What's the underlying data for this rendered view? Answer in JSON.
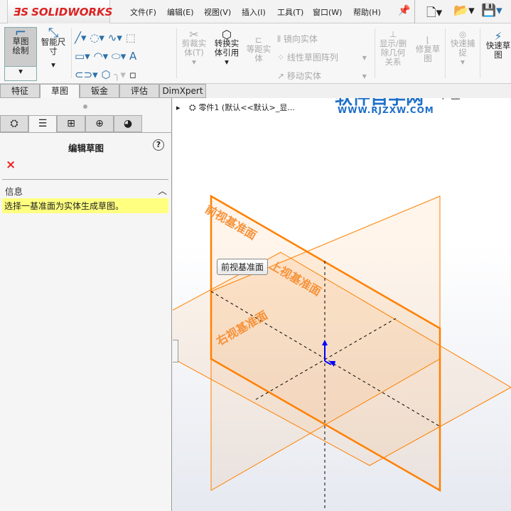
{
  "app": {
    "logo": "SOLIDWORKS",
    "menu": [
      "文件(F)",
      "编辑(E)",
      "视图(V)",
      "插入(I)",
      "工具(T)",
      "窗口(W)",
      "帮助(H)"
    ]
  },
  "ribbon": {
    "sketch": "草图绘制",
    "smart_dim": "智能尺寸",
    "trim": "剪裁实体(T)",
    "convert": "转换实体引用",
    "offset": "等距实体",
    "mirror": "镜向实体",
    "linear_pattern": "线性草图阵列",
    "move": "移动实体",
    "show_delete": "显示/删除几何关系",
    "repair": "修复草图",
    "quick_snap": "快速捕捉",
    "rapid_sketch": "快速草图"
  },
  "tabs": [
    "特征",
    "草图",
    "钣金",
    "评估",
    "DimXpert"
  ],
  "panel": {
    "title": "编辑草图",
    "help": "?",
    "close": "×",
    "section": "信息",
    "message": "选择一基准面为实体生成草图。"
  },
  "tree": {
    "item": "零件1 (默认<<默认>_显..."
  },
  "watermark": {
    "title": "软件自学网",
    "url": "WWW.RJZXW.COM"
  },
  "viewport": {
    "front_label": "前视基准面",
    "top_label": "上视基准面",
    "right_label": "右视基准面",
    "tooltip": "前视基准面",
    "plane_color": "#ff8000"
  }
}
